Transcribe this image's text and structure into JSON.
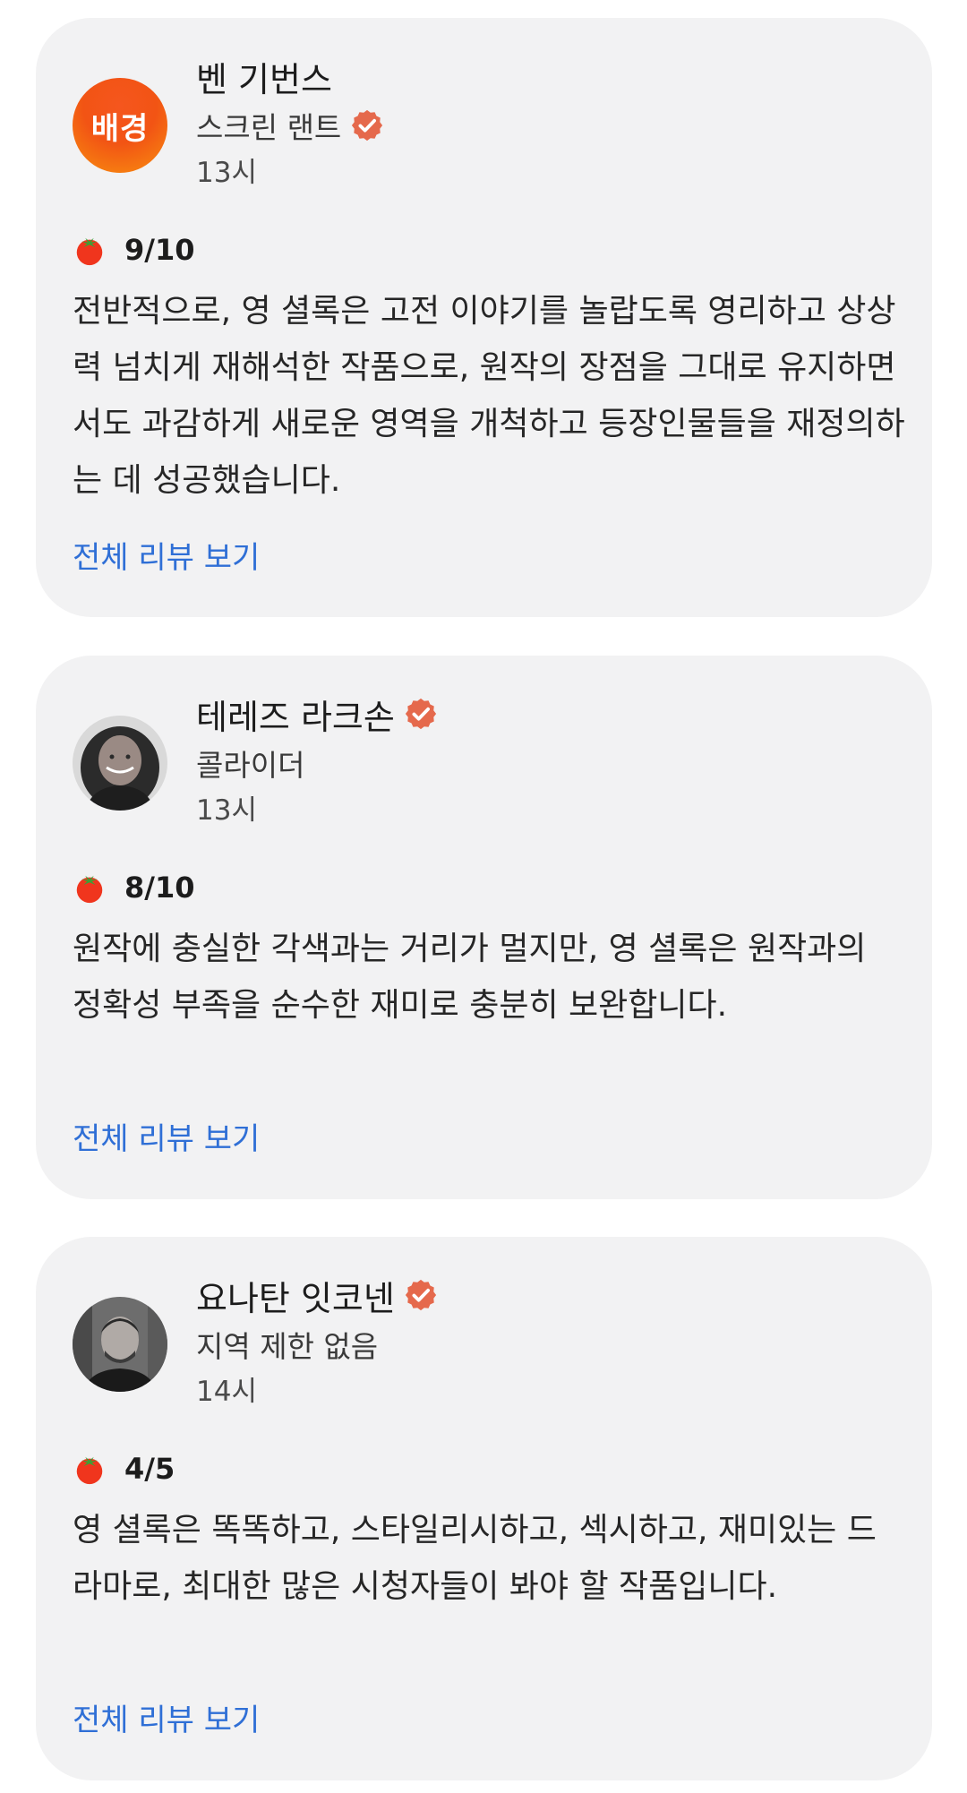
{
  "reviews": [
    {
      "avatar_initials": "배경",
      "name": "벤 기번스",
      "outlet": "스크린 랜트",
      "time": "13시",
      "rating": "9/10",
      "quote": "전반적으로, 영 셜록은 고전 이야기를 놀랍도록 영리하고 상상력 넘치게 재해석한 작품으로, 원작의 장점을 그대로 유지하면서도 과감하게 새로운 영역을 개척하고 등장인물들을 재정의하는 데 성공했습니다.",
      "link_label": "전체 리뷰 보기"
    },
    {
      "name": "테레즈 라크손",
      "outlet": "콜라이더",
      "time": "13시",
      "rating": "8/10",
      "quote": "원작에 충실한 각색과는 거리가 멀지만, 영 셜록은 원작과의 정확성 부족을 순수한 재미로 충분히 보완합니다.",
      "link_label": "전체 리뷰 보기"
    },
    {
      "name": "요나탄 잇코넨",
      "outlet": "지역 제한 없음",
      "time": "14시",
      "rating": "4/5",
      "quote": "영 셜록은 똑똑하고, 스타일리시하고, 섹시하고, 재미있는 드라마로, 최대한 많은 시청자들이 봐야 할 작품입니다.",
      "link_label": "전체 리뷰 보기"
    }
  ],
  "icons": {
    "verified": "verified-check-icon",
    "rating": "tomato-icon"
  },
  "colors": {
    "card_background": "#f2f2f3",
    "link": "#2f6fd6",
    "verified_badge": "#e5694c",
    "tomato": "#f0351d"
  }
}
